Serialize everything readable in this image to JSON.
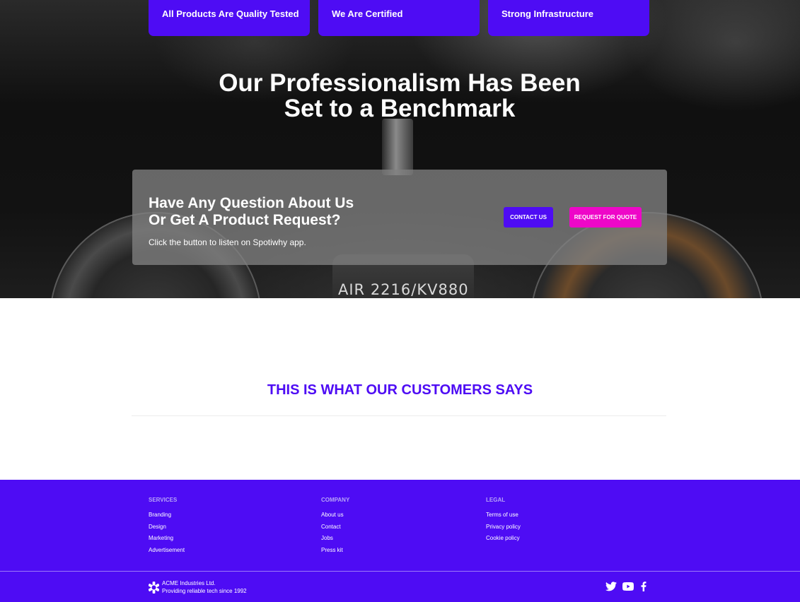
{
  "features": [
    {
      "label": "All Products Are Quality Tested"
    },
    {
      "label": "We Are Certified"
    },
    {
      "label": "Strong Infrastructure"
    }
  ],
  "hero": {
    "title_line1": "Our Professionalism Has Been",
    "title_line2": "Set to a Benchmark",
    "product_marking": "AIR 2216/KV880"
  },
  "cta": {
    "title_line1": "Have Any Question About Us",
    "title_line2": "Or Get A Product Request?",
    "subtitle": "Click the button to listen on Spotiwhy app.",
    "contact_label": "CONTACT US",
    "quote_label": "REQUEST FOR QUOTE"
  },
  "testimonials": {
    "heading": "THIS IS WHAT OUR CUSTOMERS SAYS"
  },
  "footer": {
    "services": {
      "title": "SERVICES",
      "links": [
        "Branding",
        "Design",
        "Marketing",
        "Advertisement"
      ]
    },
    "company": {
      "title": "COMPANY",
      "links": [
        "About us",
        "Contact",
        "Jobs",
        "Press kit"
      ]
    },
    "legal": {
      "title": "LEGAL",
      "links": [
        "Terms of use",
        "Privacy policy",
        "Cookie policy"
      ]
    },
    "brand_name": "ACME Industries Ltd.",
    "brand_tagline": "Providing reliable tech since 1992",
    "social_icons": [
      "twitter-icon",
      "youtube-icon",
      "facebook-icon"
    ]
  },
  "colors": {
    "primary": "#4e0cf4",
    "accent": "#ee07c8",
    "footer_muted": "#b6a3f7"
  }
}
